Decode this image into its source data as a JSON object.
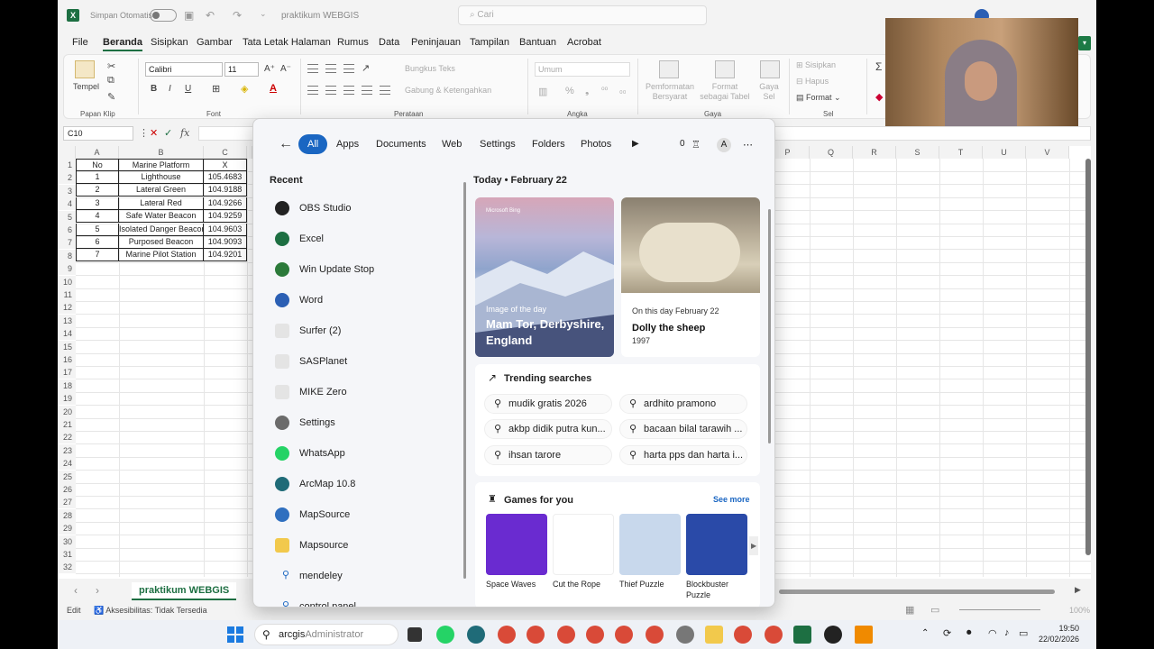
{
  "excel": {
    "autosave_label": "Simpan Otomatis",
    "doc_title": "praktikum WEBGIS",
    "search_placeholder": "Cari",
    "menu_tabs": [
      "File",
      "Beranda",
      "Sisipkan",
      "Gambar",
      "Tata Letak Halaman",
      "Rumus",
      "Data",
      "Peninjauan",
      "Tampilan",
      "Bantuan",
      "Acrobat"
    ],
    "active_tab": "Beranda",
    "ribbon": {
      "paste_label": "Tempel",
      "groups": [
        "Papan Klip",
        "Font",
        "Perataan",
        "Angka",
        "Gaya",
        "Sel"
      ],
      "font_name": "Calibri",
      "font_size": "11",
      "wrap_text": "Bungkus Teks",
      "merge_center": "Gabung & Ketengahkan",
      "number_format": "Umum",
      "cond_format": "Pemformatan Bersyarat",
      "format_table": "Format sebagai Tabel",
      "cell_styles": "Gaya Sel",
      "insert": "Sisipkan",
      "delete": "Hapus",
      "format": "Format"
    },
    "name_box": "C10",
    "columns_left": [
      "A",
      "B",
      "C"
    ],
    "columns_right": [
      "P",
      "Q",
      "R",
      "S",
      "T",
      "U",
      "V"
    ],
    "rows": [
      "1",
      "2",
      "3",
      "4",
      "5",
      "6",
      "7",
      "8",
      "9",
      "10",
      "11",
      "12",
      "13",
      "14",
      "15",
      "16",
      "17",
      "18",
      "19",
      "20",
      "21",
      "22",
      "23",
      "24",
      "25",
      "26",
      "27",
      "28",
      "29",
      "30",
      "31",
      "32"
    ],
    "table": {
      "headers": [
        "No",
        "Marine Platform",
        "X"
      ],
      "data": [
        [
          "1",
          "Lighthouse",
          "105.4683"
        ],
        [
          "2",
          "Lateral Green",
          "104.9188"
        ],
        [
          "3",
          "Lateral Red",
          "104.9266"
        ],
        [
          "4",
          "Safe Water Beacon",
          "104.9259"
        ],
        [
          "5",
          "Isolated Danger Beacon",
          "104.9603"
        ],
        [
          "6",
          "Purposed Beacon",
          "104.9093"
        ],
        [
          "7",
          "Marine Pilot Station",
          "104.9201"
        ]
      ]
    },
    "sheet_tab": "praktikum WEBGIS",
    "status_mode": "Edit",
    "accessibility": "Aksesibilitas: Tidak Tersedia",
    "zoom": "100%"
  },
  "start_search": {
    "filters": [
      "All",
      "Apps",
      "Documents",
      "Web",
      "Settings",
      "Folders",
      "Photos"
    ],
    "active_filter": "All",
    "points": "0",
    "account_initial": "A",
    "recent_title": "Recent",
    "recent_items": [
      {
        "label": "OBS Studio",
        "icon": "obs-icon",
        "color": "#222222"
      },
      {
        "label": "Excel",
        "icon": "excel-icon",
        "color": "#1d6f42"
      },
      {
        "label": "Win Update Stop",
        "icon": "win-update-icon",
        "color": "#2c7a3a"
      },
      {
        "label": "Word",
        "icon": "word-icon",
        "color": "#2b5fb4"
      },
      {
        "label": "Surfer (2)",
        "icon": "blank-app-icon",
        "color": "#e4e4e4"
      },
      {
        "label": "SASPlanet",
        "icon": "blank-app-icon",
        "color": "#e4e4e4"
      },
      {
        "label": "MIKE Zero",
        "icon": "blank-app-icon",
        "color": "#e4e4e4"
      },
      {
        "label": "Settings",
        "icon": "gear-icon",
        "color": "#6b6b6b"
      },
      {
        "label": "WhatsApp",
        "icon": "whatsapp-icon",
        "color": "#25d366"
      },
      {
        "label": "ArcMap 10.8",
        "icon": "arcmap-icon",
        "color": "#1f6b78"
      },
      {
        "label": "MapSource",
        "icon": "mapsource-icon",
        "color": "#2f6fbf"
      },
      {
        "label": "Mapsource",
        "icon": "folder-icon",
        "color": "#f2c94c"
      },
      {
        "label": "mendeley",
        "icon": "search-icon",
        "color": "#ffffff"
      },
      {
        "label": "control panel",
        "icon": "search-icon",
        "color": "#ffffff"
      }
    ],
    "today_label": "Today",
    "today_date": "February 22",
    "image_of_day": {
      "brand": "Microsoft Bing",
      "kicker": "Image of the day",
      "title": "Mam Tor, Derbyshire, England"
    },
    "on_this_day": {
      "kicker": "On this day February 22",
      "title": "Dolly the sheep",
      "year": "1997"
    },
    "trending_title": "Trending searches",
    "trending": [
      "mudik gratis 2026",
      "ardhito pramono",
      "akbp didik putra kun...",
      "bacaan bilal tarawih ...",
      "ihsan tarore",
      "harta pps dan harta i..."
    ],
    "games_title": "Games for you",
    "see_more": "See more",
    "games": [
      {
        "name": "Space Waves",
        "color": "#6a2bd0"
      },
      {
        "name": "Cut the Rope",
        "color": "#ffffff"
      },
      {
        "name": "Thief Puzzle",
        "color": "#c8d8ec"
      },
      {
        "name": "Blockbuster Puzzle",
        "color": "#2a4aa8"
      }
    ]
  },
  "taskbar": {
    "search_value": "arcgis",
    "search_placeholder": "Administrator",
    "time": "19:50",
    "date": "22/02/2026"
  }
}
